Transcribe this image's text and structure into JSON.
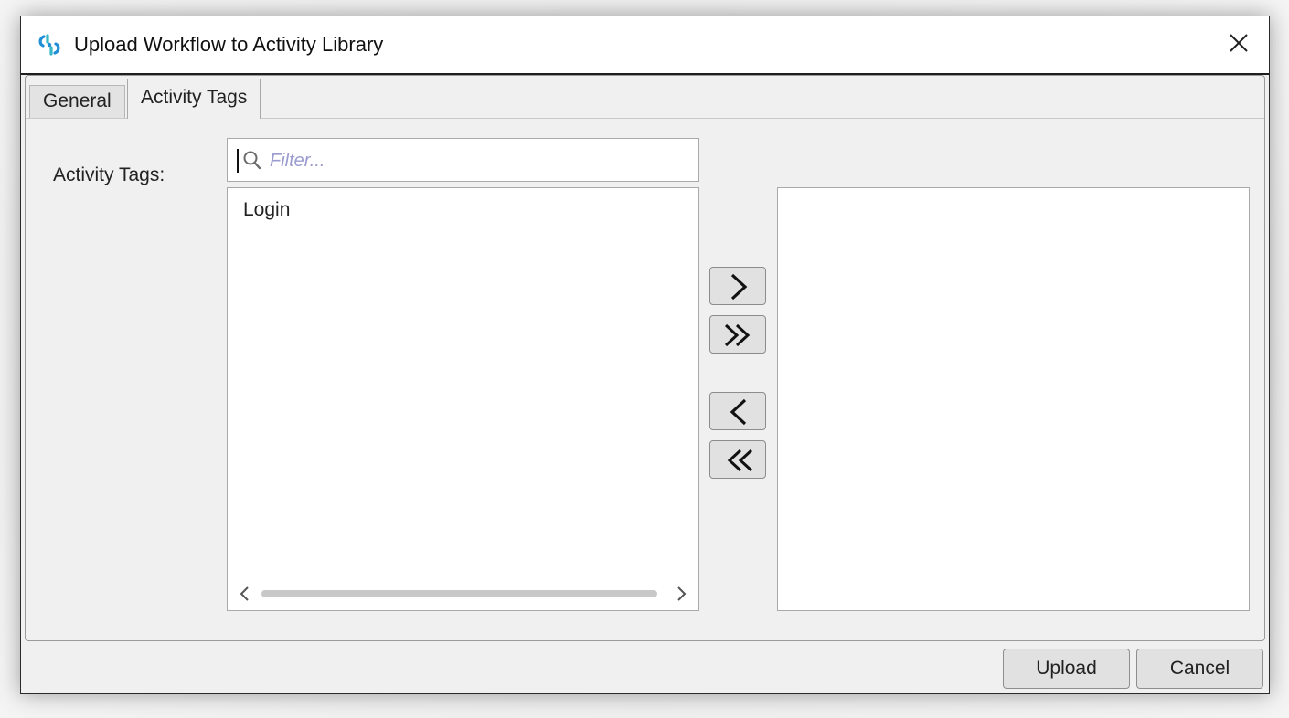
{
  "window": {
    "title": "Upload Workflow to Activity Library",
    "icon": "workflow-app-icon",
    "close_icon": "close-icon"
  },
  "tabs": [
    {
      "label": "General",
      "active": false
    },
    {
      "label": "Activity Tags",
      "active": true
    }
  ],
  "activity_tags": {
    "label": "Activity Tags:",
    "filter": {
      "placeholder": "Filter...",
      "value": "",
      "icon": "search-icon"
    },
    "available_items": [
      "Login"
    ],
    "selected_items": []
  },
  "move_buttons": [
    {
      "name": "move-right-button",
      "icon": "chevron-right-icon"
    },
    {
      "name": "move-all-right-button",
      "icon": "double-chevron-right-icon"
    },
    {
      "name": "move-left-button",
      "icon": "chevron-left-icon"
    },
    {
      "name": "move-all-left-button",
      "icon": "double-chevron-left-icon"
    }
  ],
  "footer": {
    "upload_label": "Upload",
    "cancel_label": "Cancel"
  },
  "colors": {
    "accent": "#1f8fd8",
    "accent_secondary": "#34b8c8",
    "placeholder": "#9a9ccf"
  }
}
